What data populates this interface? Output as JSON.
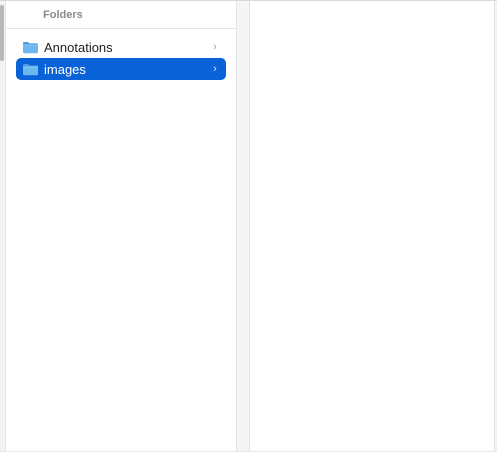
{
  "sidebar": {
    "header": "Folders",
    "items": [
      {
        "label": "Annotations",
        "icon": "folder-icon",
        "selected": false
      },
      {
        "label": "images",
        "icon": "folder-icon",
        "selected": true
      }
    ]
  },
  "colors": {
    "selection": "#0a62d8",
    "folder_body": "#6cb7f0",
    "folder_tab": "#4a9de0"
  }
}
